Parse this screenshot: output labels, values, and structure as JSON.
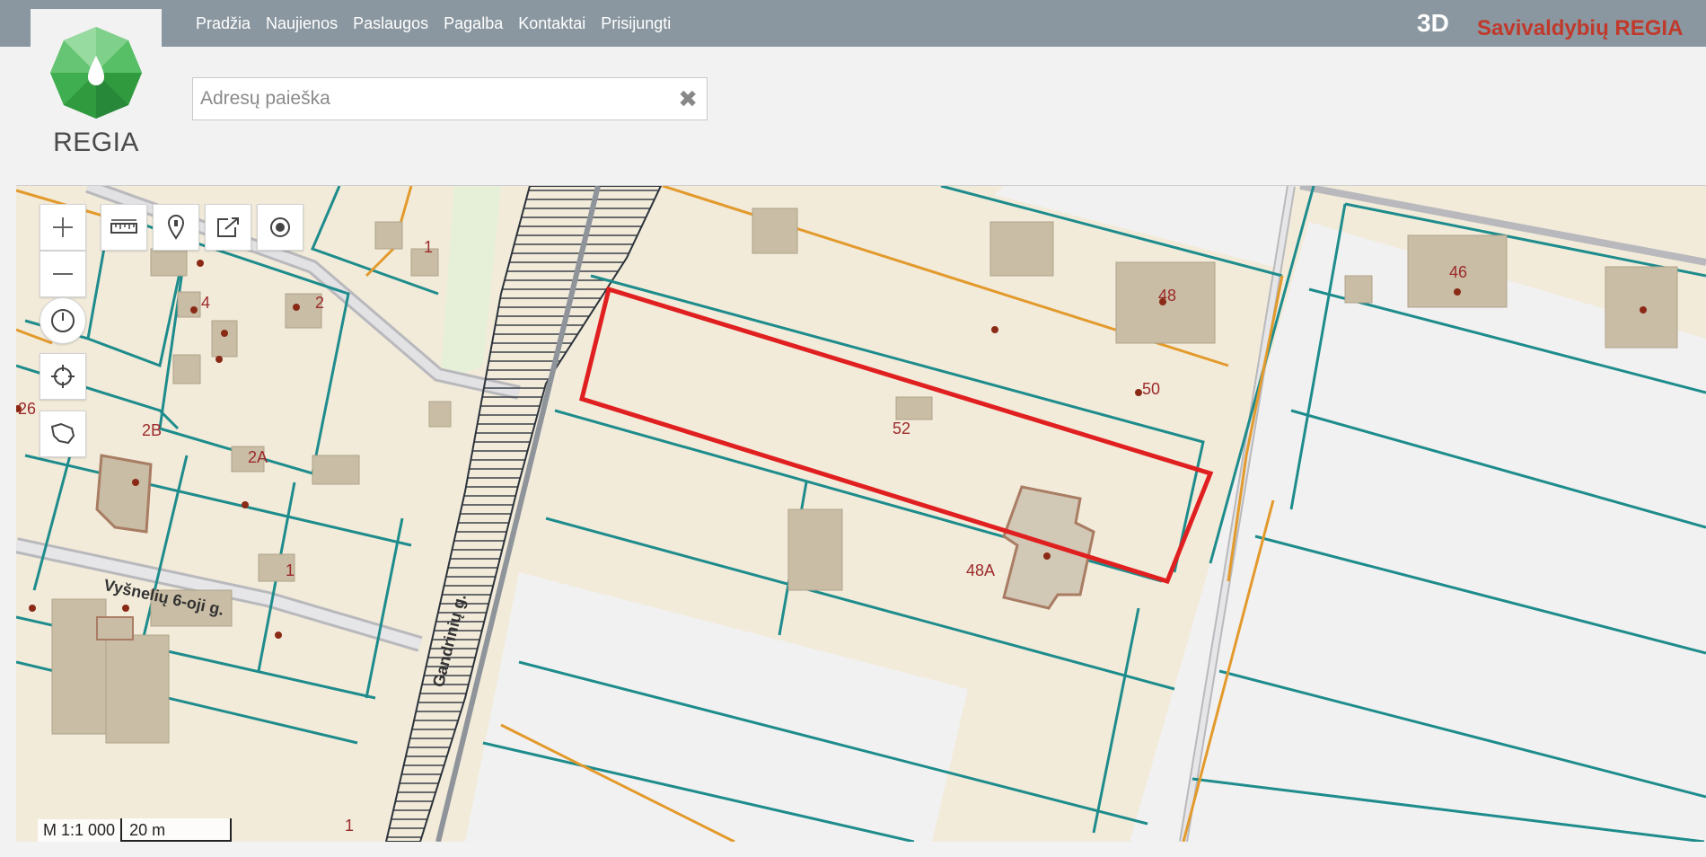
{
  "header": {
    "logo_text": "REGIA",
    "nav": [
      "Pradžia",
      "Naujienos",
      "Paslaugos",
      "Pagalba",
      "Kontaktai",
      "Prisijungti"
    ],
    "button_3d": "3D",
    "brand": "Savivaldybių REGIA"
  },
  "search": {
    "placeholder": "Adresų paieška",
    "clear_icon": "close-icon"
  },
  "map": {
    "tools": [
      "zoom-in-icon",
      "zoom-out-icon",
      "ruler-icon",
      "marker-icon",
      "share-icon",
      "target-icon",
      "history-icon",
      "locate-icon",
      "area-icon"
    ],
    "scale_ratio": "M 1:1 000",
    "scale_length": "20 m",
    "highlight_color": "#e02020",
    "parcel_labels": [
      "1",
      "4",
      "2",
      "2B",
      "2A",
      "26",
      "1",
      "48",
      "50",
      "52",
      "46",
      "48A",
      "1"
    ],
    "streets": [
      "Vyšnelių 6-oji g.",
      "Gandrinių g."
    ]
  }
}
